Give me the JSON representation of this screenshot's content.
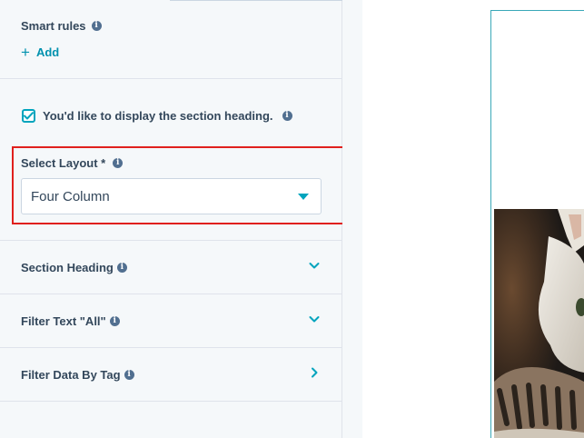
{
  "smart_rules": {
    "label": "Smart rules",
    "add_label": "Add"
  },
  "heading_checkbox": {
    "label": "You'd like to display the section heading.",
    "checked": true
  },
  "layout": {
    "label": "Select Layout *",
    "selected": "Four Column"
  },
  "accordion": [
    {
      "label": "Section Heading",
      "state": "collapsed",
      "icon": "chevron-down-icon"
    },
    {
      "label": "Filter Text \"All\"",
      "state": "collapsed",
      "icon": "chevron-down-icon"
    },
    {
      "label": "Filter Data By Tag",
      "state": "collapsed",
      "icon": "chevron-right-icon"
    }
  ],
  "colors": {
    "accent": "#00a4bd",
    "link": "#0091ae",
    "highlight": "#e0201d",
    "text": "#33475b",
    "panel_bg": "#f5f8fa"
  }
}
